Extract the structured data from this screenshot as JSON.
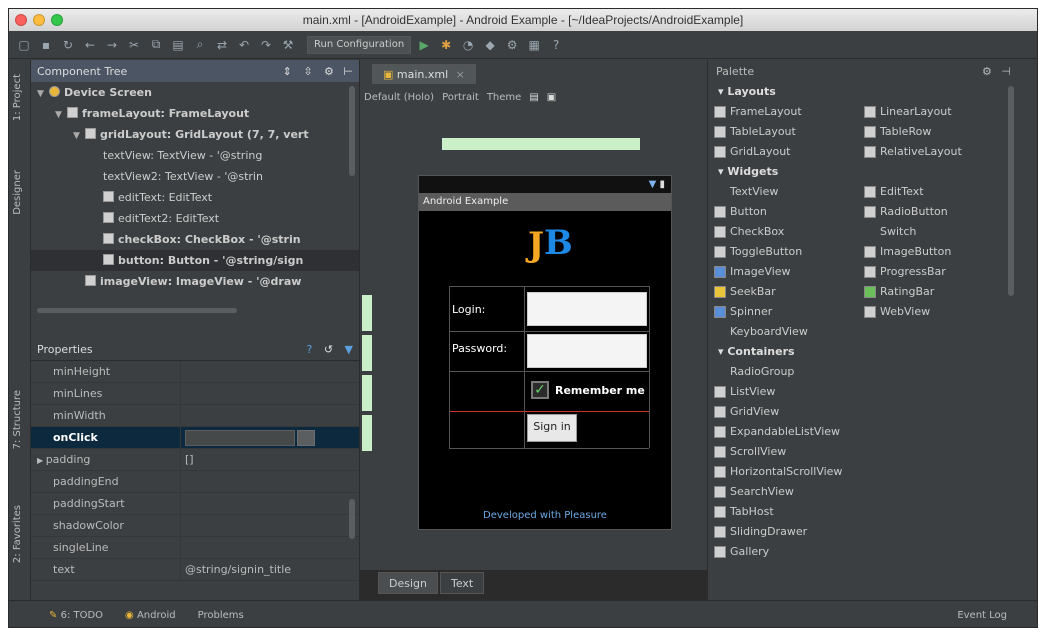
{
  "window": {
    "title": "main.xml - [AndroidExample] - Android Example - [~/IdeaProjects/AndroidExample]"
  },
  "toolbar": {
    "run_config": "Run Configuration"
  },
  "left_tabs": [
    "1: Project",
    "Designer",
    "7: Structure",
    "2: Favorites"
  ],
  "component_tree": {
    "title": "Component Tree",
    "nodes": [
      {
        "label": "Device Screen",
        "indent": 0,
        "icon": "device-icon"
      },
      {
        "label": "frameLayout: FrameLayout",
        "indent": 1,
        "icon": "frame-icon"
      },
      {
        "label": "gridLayout: GridLayout (7, 7, vert",
        "indent": 2,
        "icon": "grid-icon"
      },
      {
        "label": "textView: TextView - '@string",
        "indent": 3,
        "icon": "none"
      },
      {
        "label": "textView2: TextView - '@strin",
        "indent": 3,
        "icon": "none"
      },
      {
        "label": "editText: EditText",
        "indent": 3,
        "icon": "edit-icon"
      },
      {
        "label": "editText2: EditText",
        "indent": 3,
        "icon": "edit-icon"
      },
      {
        "label": "checkBox: CheckBox - '@strin",
        "indent": 3,
        "icon": "checkbox-icon"
      },
      {
        "label": "button: Button - '@string/sign",
        "indent": 3,
        "icon": "button-icon"
      },
      {
        "label": "imageView: ImageView - '@draw",
        "indent": 2,
        "icon": "image-icon"
      }
    ]
  },
  "properties": {
    "title": "Properties",
    "rows": [
      {
        "key": "minHeight",
        "value": ""
      },
      {
        "key": "minLines",
        "value": ""
      },
      {
        "key": "minWidth",
        "value": ""
      },
      {
        "key": "onClick",
        "value": ""
      },
      {
        "key": "padding",
        "value": "[]"
      },
      {
        "key": "paddingEnd",
        "value": ""
      },
      {
        "key": "paddingStart",
        "value": ""
      },
      {
        "key": "shadowColor",
        "value": ""
      },
      {
        "key": "singleLine",
        "value": ""
      },
      {
        "key": "text",
        "value": "@string/signin_title"
      }
    ]
  },
  "editor": {
    "tab": "main.xml",
    "toolbar": [
      "Default (Holo)",
      "Portrait",
      "Theme"
    ],
    "device": {
      "action_bar": "Android Example",
      "login_label": "Login:",
      "password_label": "Password:",
      "remember_label": "Remember me",
      "sign_button": "Sign in",
      "footer": "Developed with Pleasure"
    },
    "bottom_tabs": [
      "Design",
      "Text"
    ]
  },
  "palette": {
    "title": "Palette",
    "sections": [
      {
        "name": "Layouts",
        "items": [
          "FrameLayout",
          "LinearLayout",
          "TableLayout",
          "TableRow",
          "GridLayout",
          "RelativeLayout"
        ]
      },
      {
        "name": "Widgets",
        "items": [
          "TextView",
          "EditText",
          "Button",
          "RadioButton",
          "CheckBox",
          "Switch",
          "ToggleButton",
          "ImageButton",
          "ImageView",
          "ProgressBar",
          "SeekBar",
          "RatingBar",
          "Spinner",
          "WebView",
          "KeyboardView"
        ]
      },
      {
        "name": "Containers",
        "items": [
          "RadioGroup",
          "ListView",
          "GridView",
          "ExpandableListView",
          "ScrollView",
          "HorizontalScrollView",
          "SearchView",
          "TabHost",
          "SlidingDrawer",
          "Gallery"
        ]
      }
    ]
  },
  "bottom_bar": {
    "items": [
      "6: TODO",
      "Android",
      "Problems"
    ],
    "event_log": "Event Log"
  }
}
